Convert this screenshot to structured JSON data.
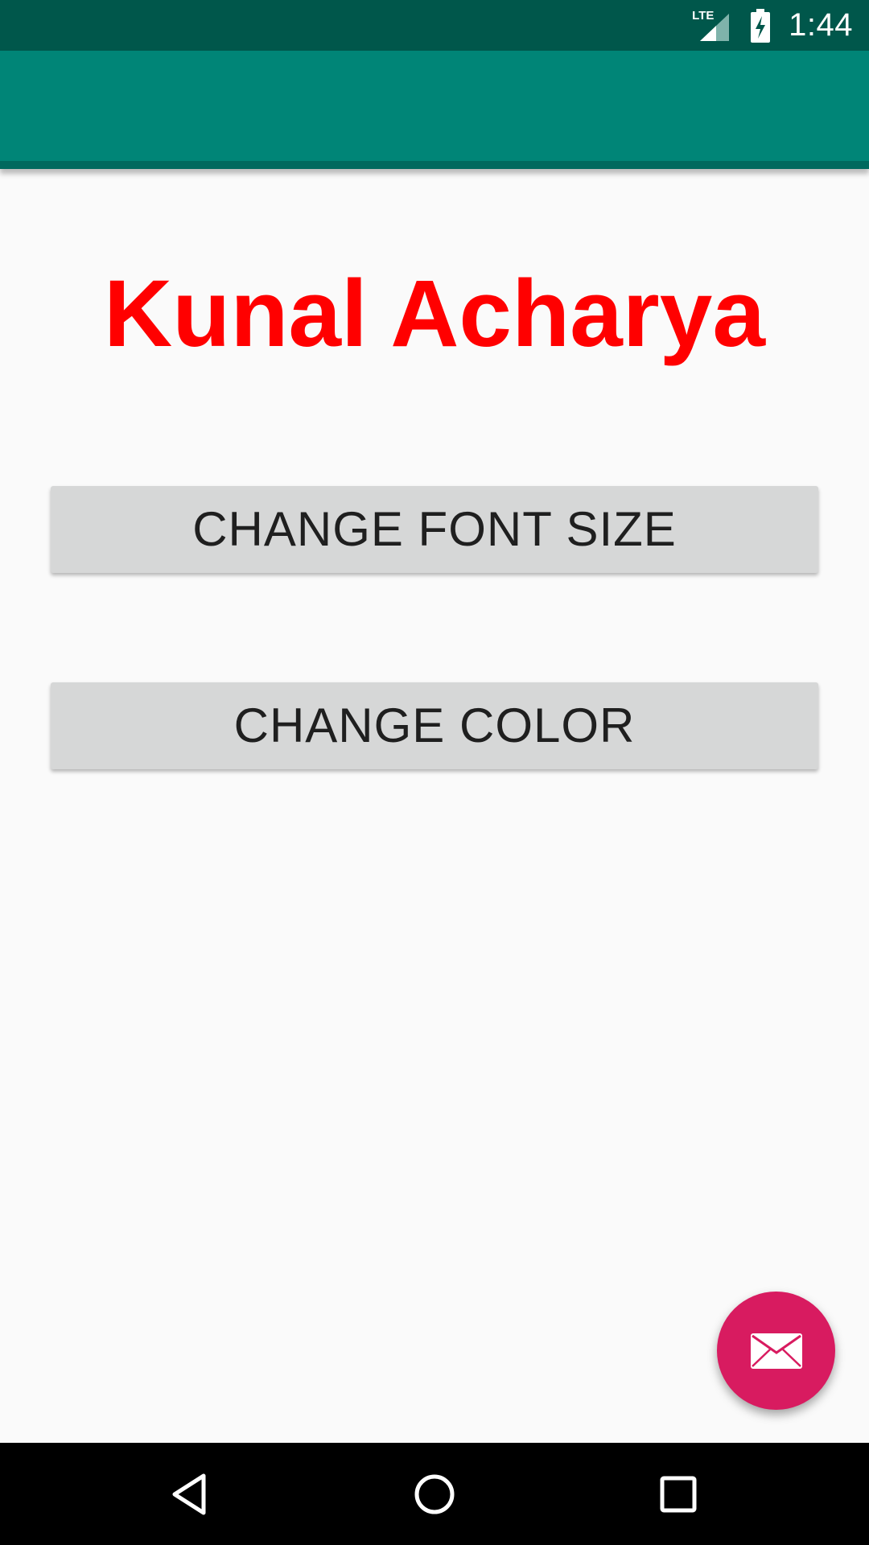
{
  "status_bar": {
    "network_label": "LTE",
    "time": "1:44",
    "color": "#00574b"
  },
  "app_bar": {
    "color": "#008577"
  },
  "main": {
    "name": "Kunal Acharya",
    "name_color": "#ff0000",
    "buttons": {
      "change_font_size": "CHANGE FONT SIZE",
      "change_color": "CHANGE COLOR"
    }
  },
  "fab": {
    "icon": "mail-icon",
    "color": "#d81b60"
  },
  "nav_bar": {
    "back_icon": "back-icon",
    "home_icon": "home-icon",
    "recents_icon": "recents-icon"
  }
}
